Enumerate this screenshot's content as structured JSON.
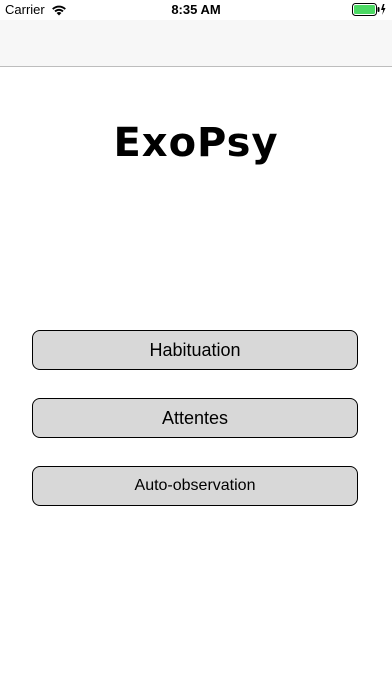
{
  "status_bar": {
    "carrier": "Carrier",
    "time": "8:35 AM",
    "wifi_icon": "wifi-icon",
    "battery_icon": "battery-icon",
    "battery_color": "#4cd964",
    "battery_level": 1.0
  },
  "main": {
    "title": "ExoPsy",
    "buttons": [
      {
        "label": "Habituation"
      },
      {
        "label": "Attentes"
      },
      {
        "label": "Auto-observation"
      }
    ]
  },
  "colors": {
    "nav_bar_bg": "#f7f7f7",
    "button_bg": "#d8d8d8",
    "button_border": "#000000"
  }
}
